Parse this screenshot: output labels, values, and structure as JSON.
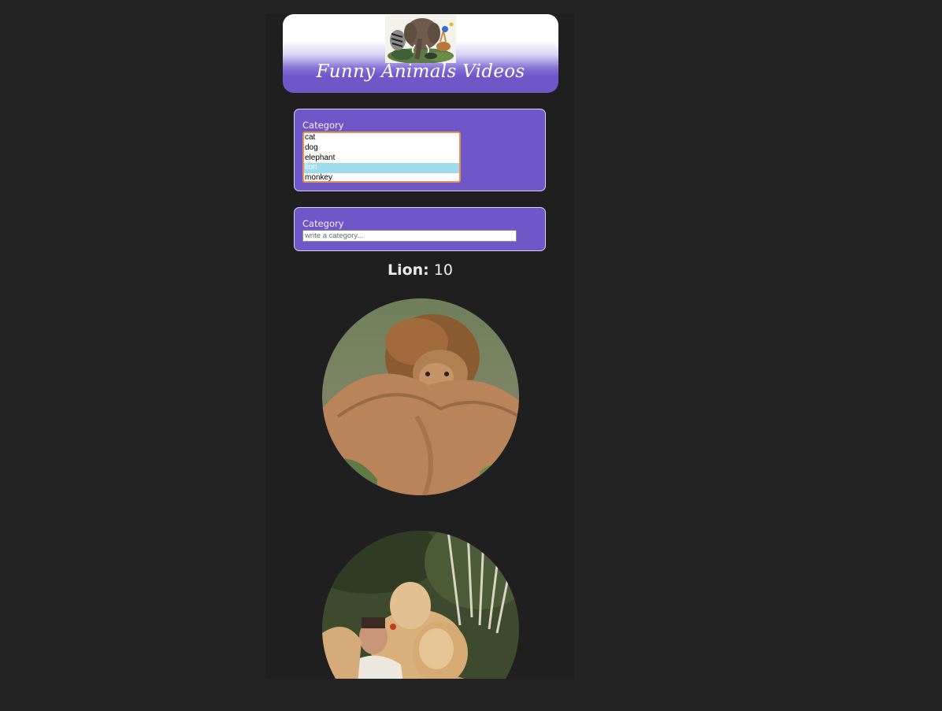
{
  "header": {
    "title": "Funny Animals Videos"
  },
  "category_select": {
    "label": "Category",
    "options": [
      "cat",
      "dog",
      "elephant",
      "lion",
      "monkey"
    ],
    "selected": "lion"
  },
  "category_search": {
    "label": "Category",
    "placeholder": "write a category...",
    "value": ""
  },
  "result": {
    "name": "Lion:",
    "count": "10"
  },
  "videos": [
    {
      "icon": "lion-photo"
    },
    {
      "icon": "lions-hugging-man-photo"
    }
  ],
  "colors": {
    "background": "#232323",
    "panel": "#7057c8",
    "selected_option": "#9edbef",
    "listbox_border": "#e8904f"
  }
}
